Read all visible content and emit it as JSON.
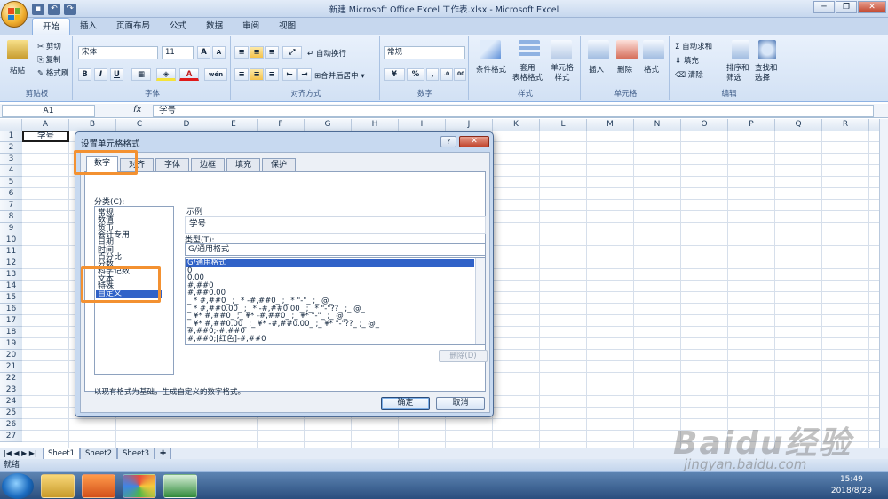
{
  "window": {
    "title": "新建 Microsoft Office Excel 工作表.xlsx - Microsoft Excel",
    "minimize": "─",
    "restore": "❐",
    "close": "✕"
  },
  "qat": {
    "save": "▪",
    "undo": "↶",
    "redo": "↷"
  },
  "ribbon": {
    "tabs": [
      "开始",
      "插入",
      "页面布局",
      "公式",
      "数据",
      "审阅",
      "视图"
    ],
    "clipboard": {
      "paste": "粘贴",
      "cut": "剪切",
      "copy": "复制",
      "format_painter": "格式刷",
      "group": "剪贴板"
    },
    "font": {
      "family": "宋体",
      "size": "11",
      "grow": "A",
      "shrink": "A",
      "bold": "B",
      "italic": "I",
      "underline": "U",
      "phonetic": "wén",
      "group": "字体"
    },
    "alignment": {
      "wrap": "自动换行",
      "merge": "合并后居中",
      "group": "对齐方式"
    },
    "number": {
      "format": "常规",
      "percent": "%",
      "comma": ",",
      "group": "数字"
    },
    "styles": {
      "conditional": "条件格式",
      "table": "套用\n表格格式",
      "cell": "单元格\n样式",
      "group": "样式"
    },
    "cells": {
      "insert": "插入",
      "delete": "删除",
      "format": "格式",
      "group": "单元格"
    },
    "editing": {
      "autosum": "Σ 自动求和",
      "fill": "填充",
      "clear": "清除",
      "sort": "排序和\n筛选",
      "find": "查找和\n选择",
      "group": "编辑"
    }
  },
  "formula_bar": {
    "name_box": "A1",
    "fx": "fx",
    "value": "学号"
  },
  "sheet": {
    "columns": [
      "A",
      "B",
      "C",
      "D",
      "E",
      "F",
      "G",
      "H",
      "I",
      "J",
      "K",
      "L",
      "M",
      "N",
      "O",
      "P",
      "Q",
      "R"
    ],
    "rows": [
      "1",
      "2",
      "3",
      "4",
      "5",
      "6",
      "7",
      "8",
      "9",
      "10",
      "11",
      "12",
      "13",
      "14",
      "15",
      "16",
      "17",
      "18",
      "19",
      "20",
      "21",
      "22",
      "23",
      "24",
      "25",
      "26",
      "27"
    ],
    "a1": "学号",
    "tabs": [
      "Sheet1",
      "Sheet2",
      "Sheet3"
    ],
    "status": "就绪"
  },
  "dialog": {
    "title": "设置单元格格式",
    "help": "?",
    "close": "✕",
    "tabs": [
      "数字",
      "对齐",
      "字体",
      "边框",
      "填充",
      "保护"
    ],
    "category_label": "分类(C):",
    "categories": [
      "常规",
      "数值",
      "货币",
      "会计专用",
      "日期",
      "时间",
      "百分比",
      "分数",
      "科学记数",
      "文本",
      "特殊",
      "自定义"
    ],
    "selected_category": "自定义",
    "sample_label": "示例",
    "sample_value": "学号",
    "type_label": "类型(T):",
    "type_value": "G/通用格式",
    "type_list": [
      "G/通用格式",
      "0",
      "0.00",
      "#,##0",
      "#,##0.00",
      "_ * #,##0_ ;_ * -#,##0_ ;_ * \"-\"_ ;_ @_",
      "_ * #,##0.00_ ;_ * -#,##0.00_ ;_ * \"-\"??_ ;_ @_",
      "_ ¥* #,##0_ ;_ ¥* -#,##0_ ;_ ¥* \"-\"_ ;_ @_",
      "_ ¥* #,##0.00_ ;_ ¥* -#,##0.00_ ;_ ¥* \"-\"??_ ;_ @_",
      "#,##0;-#,##0",
      "#,##0;[红色]-#,##0"
    ],
    "delete": "删除(D)",
    "hint": "以现有格式为基础，生成自定义的数字格式。",
    "ok": "确定",
    "cancel": "取消"
  },
  "taskbar": {
    "time": "15:49",
    "date": "2018/8/29"
  },
  "watermark": {
    "brand": "Baidu经验",
    "url": "jingyan.baidu.com"
  }
}
